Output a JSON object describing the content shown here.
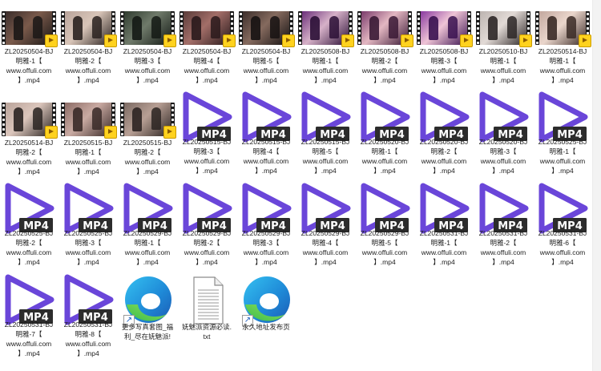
{
  "colors": {
    "mp4_purple": "#6a46d9",
    "mp4_badge_bg": "#2c2c2c",
    "badge_yellow": "#ffd21e"
  },
  "icons": {
    "video_thumbnail": "video-thumbnail-icon",
    "mp4": "mp4-file-icon",
    "edge": "edge-shortcut-icon",
    "txt": "text-file-icon"
  },
  "files": [
    {
      "type": "thumb",
      "name_lines": [
        "ZL20250504-BJ",
        "明雅-1【",
        "www.offuli.com",
        "】.mp4"
      ],
      "palette": [
        "#3a2d2b",
        "#1b1716",
        "#7a5a4b"
      ]
    },
    {
      "type": "thumb",
      "name_lines": [
        "ZL20250504-BJ",
        "明雅-2【",
        "www.offuli.com",
        "】.mp4"
      ],
      "palette": [
        "#b9a49b",
        "#2a2220",
        "#d8c5b8"
      ]
    },
    {
      "type": "thumb",
      "name_lines": [
        "ZL20250504-BJ",
        "明雅-3【",
        "www.offuli.com",
        "】.mp4"
      ],
      "palette": [
        "#2f3b2f",
        "#141a15",
        "#6f7a6a"
      ]
    },
    {
      "type": "thumb",
      "name_lines": [
        "ZL20250504-BJ",
        "明雅-4【",
        "www.offuli.com",
        "】.mp4"
      ],
      "palette": [
        "#5a3c3a",
        "#2a1a1c",
        "#a36e68"
      ]
    },
    {
      "type": "thumb",
      "name_lines": [
        "ZL20250504-BJ",
        "明雅-5【",
        "www.offuli.com",
        "】.mp4"
      ],
      "palette": [
        "#3d2f2c",
        "#161212",
        "#856a5e"
      ]
    },
    {
      "type": "thumb",
      "name_lines": [
        "ZL20250508-BJ",
        "明雅-1【",
        "www.offuli.com",
        "】.mp4"
      ],
      "palette": [
        "#6b2f7a",
        "#2b0f36",
        "#d6b1c8"
      ]
    },
    {
      "type": "thumb",
      "name_lines": [
        "ZL20250508-BJ",
        "明雅-2【",
        "www.offuli.com",
        "】.mp4"
      ],
      "palette": [
        "#7a3b6b",
        "#3a1935",
        "#e3b7c2"
      ]
    },
    {
      "type": "thumb",
      "name_lines": [
        "ZL20250508-BJ",
        "明雅-3【",
        "www.offuli.com",
        "】.mp4"
      ],
      "palette": [
        "#8a3aa0",
        "#3a1250",
        "#efc4d6"
      ]
    },
    {
      "type": "thumb",
      "name_lines": [
        "ZL20250510-BJ",
        "明雅-1【",
        "www.offuli.com",
        "】.mp4"
      ],
      "palette": [
        "#bcb4b0",
        "#2c2626",
        "#e2dad6"
      ]
    },
    {
      "type": "thumb",
      "name_lines": [
        "ZL20250514-BJ",
        "明雅-1【",
        "www.offuli.com",
        "】.mp4"
      ],
      "palette": [
        "#c2a79e",
        "#3a2a26",
        "#ead6cc"
      ]
    },
    {
      "type": "thumb",
      "name_lines": [
        "ZL20250514-BJ",
        "明雅-2【",
        "www.offuli.com",
        "】.mp4"
      ],
      "palette": [
        "#b9a39a",
        "#2a2422",
        "#dbc6bc"
      ]
    },
    {
      "type": "thumb",
      "name_lines": [
        "ZL20250515-BJ",
        "明雅-1【",
        "www.offuli.com",
        "】.mp4"
      ],
      "palette": [
        "#8c6c66",
        "#3a2a28",
        "#c9aaa2"
      ]
    },
    {
      "type": "thumb",
      "name_lines": [
        "ZL20250515-BJ",
        "明雅-2【",
        "www.offuli.com",
        "】.mp4"
      ],
      "palette": [
        "#7b6a63",
        "#2c2422",
        "#b79f94"
      ]
    },
    {
      "type": "mp4",
      "name_lines": [
        "ZL20250515-BJ",
        "明雅-3【",
        "www.offuli.com",
        "】.mp4"
      ]
    },
    {
      "type": "mp4",
      "name_lines": [
        "ZL20250515-BJ",
        "明雅-4【",
        "www.offuli.com",
        "】.mp4"
      ]
    },
    {
      "type": "mp4",
      "name_lines": [
        "ZL20250515-BJ",
        "明雅-5【",
        "www.offuli.com",
        "】.mp4"
      ]
    },
    {
      "type": "mp4",
      "name_lines": [
        "ZL20250520-BJ",
        "明雅-1【",
        "www.offuli.com",
        "】.mp4"
      ]
    },
    {
      "type": "mp4",
      "name_lines": [
        "ZL20250520-BJ",
        "明雅-2【",
        "www.offuli.com",
        "】.mp4"
      ]
    },
    {
      "type": "mp4",
      "name_lines": [
        "ZL20250520-BJ",
        "明雅-3【",
        "www.offuli.com",
        "】.mp4"
      ]
    },
    {
      "type": "mp4",
      "name_lines": [
        "ZL20250525-BJ",
        "明雅-1【",
        "www.offuli.com",
        "】.mp4"
      ]
    },
    {
      "type": "mp4",
      "name_lines": [
        "ZL20250525-BJ",
        "明雅-2【",
        "www.offuli.com",
        "】.mp4"
      ]
    },
    {
      "type": "mp4",
      "name_lines": [
        "ZL20250525-BJ",
        "明雅-3【",
        "www.offuli.com",
        "】.mp4"
      ]
    },
    {
      "type": "mp4",
      "name_lines": [
        "ZL20250529-BJ",
        "明雅-1【",
        "www.offuli.com",
        "】.mp4"
      ]
    },
    {
      "type": "mp4",
      "name_lines": [
        "ZL20250529-BJ",
        "明雅-2【",
        "www.offuli.com",
        "】.mp4"
      ]
    },
    {
      "type": "mp4",
      "name_lines": [
        "ZL20250529-BJ",
        "明雅-3【",
        "www.offuli.com",
        "】.mp4"
      ]
    },
    {
      "type": "mp4",
      "name_lines": [
        "ZL20250529-BJ",
        "明雅-4【",
        "www.offuli.com",
        "】.mp4"
      ]
    },
    {
      "type": "mp4",
      "name_lines": [
        "ZL20250529-BJ",
        "明雅-5【",
        "www.offuli.com",
        "】.mp4"
      ]
    },
    {
      "type": "mp4",
      "name_lines": [
        "ZL20250531-BJ",
        "明雅-1【",
        "www.offuli.com",
        "】.mp4"
      ]
    },
    {
      "type": "mp4",
      "name_lines": [
        "ZL20250531-BJ",
        "明雅-2【",
        "www.offuli.com",
        "】.mp4"
      ]
    },
    {
      "type": "mp4",
      "name_lines": [
        "ZL20250531-BJ",
        "明雅-6【",
        "www.offuli.com",
        "】.mp4"
      ]
    },
    {
      "type": "mp4",
      "name_lines": [
        "ZL20250531-BJ",
        "明雅-7【",
        "www.offuli.com",
        "】.mp4"
      ]
    },
    {
      "type": "mp4",
      "name_lines": [
        "ZL20250531-BJ",
        "明雅-8【",
        "www.offuli.com",
        "】.mp4"
      ]
    },
    {
      "type": "edge",
      "name_lines": [
        "更多写真套图_福",
        "利_尽在妩魅派!"
      ]
    },
    {
      "type": "txt",
      "name_lines": [
        "妩魅派资源必读.",
        "txt"
      ]
    },
    {
      "type": "edge",
      "name_lines": [
        "永久地址发布页"
      ]
    }
  ]
}
